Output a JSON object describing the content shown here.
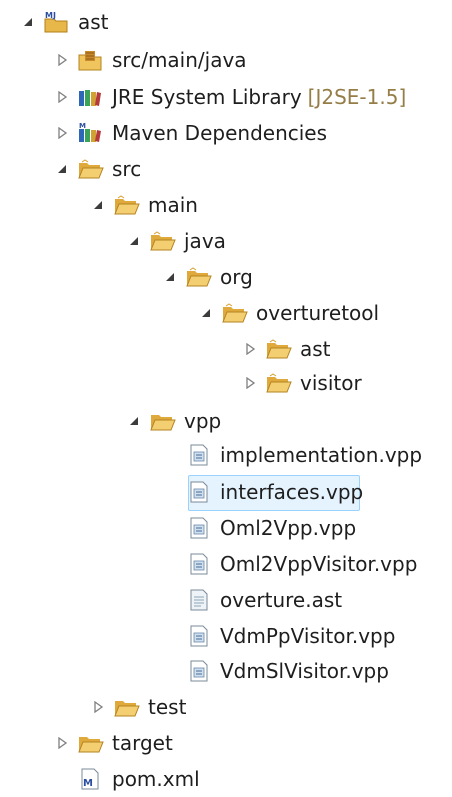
{
  "tree": {
    "root_label": "ast",
    "src_main_java_label": "src/main/java",
    "jre_label": "JRE System Library",
    "jre_decoration": "[J2SE-1.5]",
    "maven_label": "Maven Dependencies",
    "src_label": "src",
    "main_label": "main",
    "java_label": "java",
    "org_label": "org",
    "overturetool_label": "overturetool",
    "ast_pkg_label": "ast",
    "visitor_label": "visitor",
    "vpp_label": "vpp",
    "files": [
      "implementation.vpp",
      "interfaces.vpp",
      "Oml2Vpp.vpp",
      "Oml2VppVisitor.vpp",
      "overture.ast",
      "VdmPpVisitor.vpp",
      "VdmSlVisitor.vpp"
    ],
    "selected_file": "interfaces.vpp",
    "test_label": "test",
    "target_label": "target",
    "pom_label": "pom.xml"
  },
  "icons": {
    "expanded": "expanded-triangle-icon",
    "collapsed": "collapsed-triangle-icon",
    "folder": "folder-icon",
    "package_root": "java-source-folder-icon",
    "library": "library-icon",
    "maven": "maven-icon",
    "file": "vpp-file-icon",
    "ast_file": "ast-file-icon",
    "pom": "pom-file-icon"
  }
}
